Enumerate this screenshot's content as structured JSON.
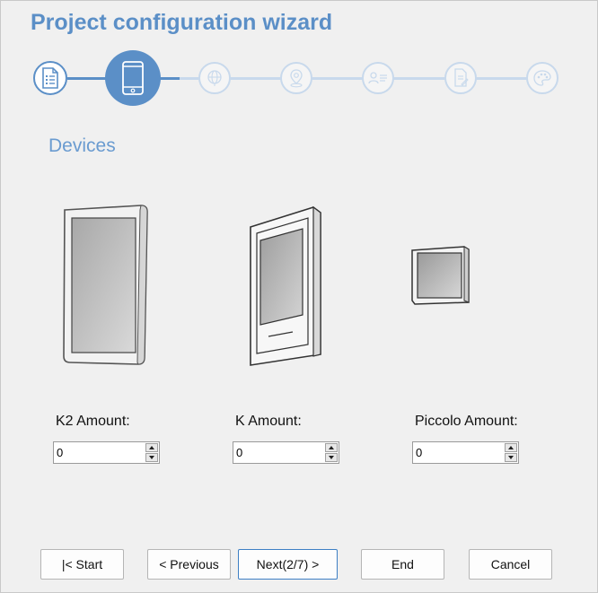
{
  "window": {
    "title": "Project configuration wizard"
  },
  "stepper": {
    "current_step": 2,
    "total_steps": 7,
    "steps": [
      {
        "icon": "checklist-icon",
        "state": "done"
      },
      {
        "icon": "smartphone-icon",
        "state": "active"
      },
      {
        "icon": "globe-icon",
        "state": "todo"
      },
      {
        "icon": "location-pin-icon",
        "state": "todo"
      },
      {
        "icon": "contact-card-icon",
        "state": "todo"
      },
      {
        "icon": "document-edit-icon",
        "state": "todo"
      },
      {
        "icon": "palette-icon",
        "state": "todo"
      }
    ]
  },
  "section": {
    "title": "Devices"
  },
  "devices": [
    {
      "label": "K2 Amount:",
      "value": "0"
    },
    {
      "label": "K Amount:",
      "value": "0"
    },
    {
      "label": "Piccolo Amount:",
      "value": "0"
    }
  ],
  "buttons": {
    "start": "|< Start",
    "previous": "< Previous",
    "next": "Next(2/7) >",
    "end": "End",
    "cancel": "Cancel"
  },
  "colors": {
    "accent": "#5b8fc7",
    "section_title": "#6a9bd0",
    "inactive_step": "#c8d9ec"
  }
}
